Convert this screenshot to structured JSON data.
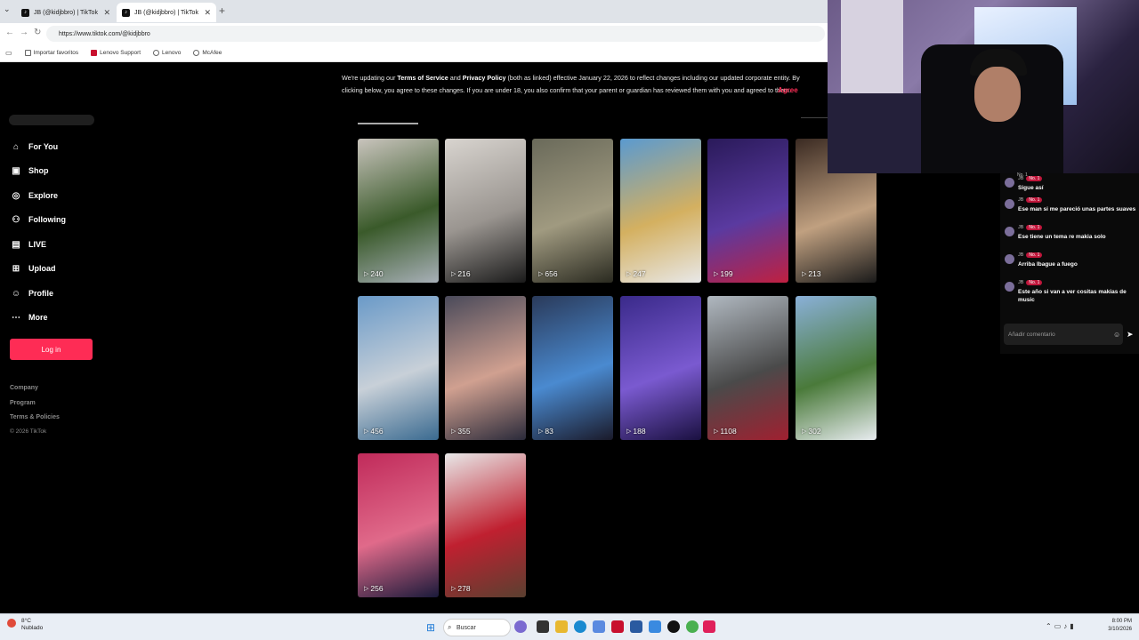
{
  "browser": {
    "tabs": [
      {
        "title": "JB (@kidjbbro) | TikTok"
      },
      {
        "title": "JB (@kidjbbro) | TikTok"
      }
    ],
    "url": "https://www.tiktok.com/@kidjbbro",
    "bookmarks": [
      "Importar favoritos",
      "Lenovo Support",
      "Lenovo",
      "McAfee"
    ]
  },
  "sidebar": {
    "items": [
      {
        "label": "For You",
        "icon": "home-icon"
      },
      {
        "label": "Shop",
        "icon": "shop-icon"
      },
      {
        "label": "Explore",
        "icon": "compass-icon"
      },
      {
        "label": "Following",
        "icon": "following-icon"
      },
      {
        "label": "LIVE",
        "icon": "live-icon"
      },
      {
        "label": "Upload",
        "icon": "upload-icon"
      },
      {
        "label": "Profile",
        "icon": "profile-icon"
      },
      {
        "label": "More",
        "icon": "more-icon"
      }
    ],
    "login_label": "Log in",
    "footer": {
      "company": "Company",
      "program": "Program",
      "terms": "Terms & Policies",
      "copyright": "© 2026 TikTok"
    }
  },
  "banner": {
    "text_1": "We're updating our ",
    "tos": "Terms of Service",
    "and": " and ",
    "privacy": "Privacy Policy",
    "text_2": " (both as linked) effective January 22, 2026 to reflect changes including our updated corporate entity. By clicking below, you agree to these changes. If you are under 18, you also confirm that your parent or guardian has reviewed them with you and agreed to them.",
    "agree_label": "Agree"
  },
  "videos": [
    {
      "views": "240",
      "colors": [
        "#c9c4bd",
        "#3a5a2a",
        "#a8b0b8"
      ]
    },
    {
      "views": "216",
      "colors": [
        "#d8d4cf",
        "#9a9590",
        "#1a1a1a"
      ]
    },
    {
      "views": "656",
      "colors": [
        "#6a6a5a",
        "#a09a80",
        "#2a2a20"
      ]
    },
    {
      "views": "247",
      "colors": [
        "#5a9ad0",
        "#d4b060",
        "#e8e8e8"
      ]
    },
    {
      "views": "199",
      "colors": [
        "#2a1a5a",
        "#5a3aa0",
        "#c02040"
      ]
    },
    {
      "views": "213",
      "colors": [
        "#3a2a22",
        "#c0a080",
        "#1a1a1a"
      ]
    },
    {
      "views": "456",
      "colors": [
        "#6a9ac8",
        "#c8d0d8",
        "#3a6a90"
      ]
    },
    {
      "views": "355",
      "colors": [
        "#4a4a5a",
        "#d0a090",
        "#2a2a3a"
      ]
    },
    {
      "views": "83",
      "colors": [
        "#2a3a5a",
        "#4a8ad0",
        "#1a1a2a"
      ]
    },
    {
      "views": "188",
      "colors": [
        "#3a2a8a",
        "#7a5ad0",
        "#1a1040"
      ]
    },
    {
      "views": "1108",
      "colors": [
        "#b0b8c0",
        "#4a4a4a",
        "#a02030"
      ]
    },
    {
      "views": "302",
      "colors": [
        "#8ab0d8",
        "#4a7a3a",
        "#e8ecf0"
      ]
    },
    {
      "views": "256",
      "colors": [
        "#c02a5a",
        "#e06a8a",
        "#1a1a3a"
      ]
    },
    {
      "views": "278",
      "colors": [
        "#e8e8e8",
        "#c02030",
        "#5a4030"
      ]
    }
  ],
  "chat": {
    "top_label": "No. 1",
    "messages": [
      {
        "user": "JB",
        "badge": "No. 1",
        "text": "Sigue así"
      },
      {
        "user": "JB",
        "badge": "No. 1",
        "text": "Ese man si me pareció unas partes suaves"
      },
      {
        "user": "JB",
        "badge": "No. 1",
        "text": "Ese tiene un tema re makia solo"
      },
      {
        "user": "JB",
        "badge": "No. 1",
        "text": "Arriba Ibague a fuego"
      },
      {
        "user": "JB",
        "badge": "No. 1",
        "text": "Este año si van a ver cositas makias de music"
      }
    ],
    "input_placeholder": "Añadir comentario"
  },
  "taskbar": {
    "weather_temp": "8°C",
    "weather_desc": "Nublado",
    "search_label": "Buscar",
    "time": "8:00 PM",
    "date": "3/10/2026"
  }
}
